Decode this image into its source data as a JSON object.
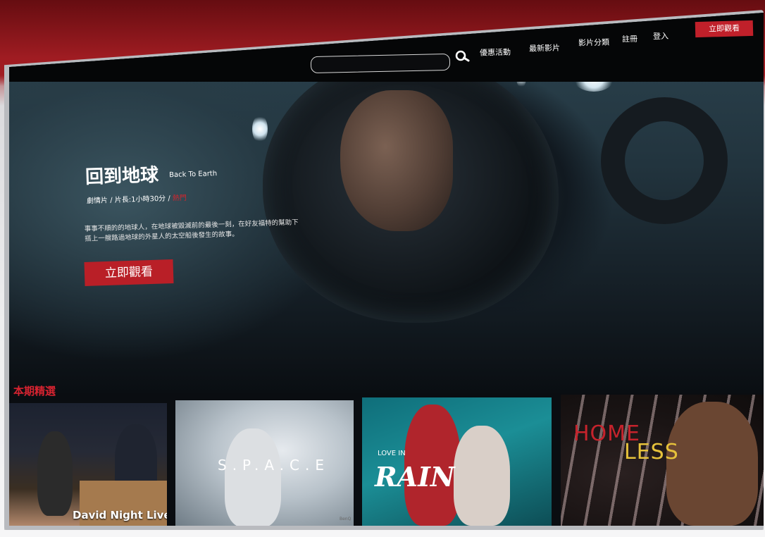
{
  "nav": {
    "items": [
      "優惠活動",
      "最新影片",
      "影片分類",
      "註冊",
      "登入"
    ],
    "cta_label": "立即觀看",
    "search_placeholder": ""
  },
  "hero": {
    "title": "回到地球",
    "title_en": "Back To Earth",
    "meta_prefix": "劇情片 / 片長:1小時30分 /",
    "meta_tag": "熱門",
    "description_line1": "事事不順的的地球人，在地球被毀滅前的最後一刻，在好友福特的幫助下",
    "description_line2": "搭上一艘路過地球的外星人的太空船後發生的故事。",
    "cta_label": "立即觀看"
  },
  "featured": {
    "section_title": "本期精選",
    "cards": [
      {
        "label": "David Night Live"
      },
      {
        "label": "S.P.A.C.E"
      },
      {
        "label_small": "LOVE IN",
        "label_big": "RAIN"
      },
      {
        "label_top": "HOME",
        "label_bottom": "LESS"
      }
    ]
  },
  "device": {
    "brand": "BenQ"
  },
  "colors": {
    "accent": "#c0202a",
    "background": "#050607",
    "section_title": "#d62330"
  }
}
